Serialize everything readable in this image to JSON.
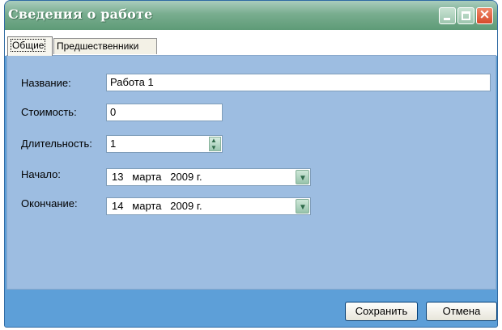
{
  "window": {
    "title": "Сведения о работе",
    "accent_color": "#5e9b77",
    "panel_color": "#9dbde1",
    "frame_color": "#5d9fd8"
  },
  "tabs": [
    {
      "label": "Общие",
      "selected": true
    },
    {
      "label": "Предшественники",
      "selected": false
    }
  ],
  "form": {
    "name_label": "Название:",
    "name_value": "Работа 1",
    "cost_label": "Стоимость:",
    "cost_value": "0",
    "duration_label": "Длительность:",
    "duration_value": "1",
    "start_label": "Начало:",
    "start_value": "13   марта   2009 г.",
    "end_label": "Окончание:",
    "end_value": "14   марта   2009 г."
  },
  "buttons": {
    "save": "Сохранить",
    "cancel": "Отмена"
  },
  "icons": {
    "minimize": "minimize-icon",
    "maximize": "maximize-icon",
    "close": "close-icon",
    "spin": "spin-updown-icon",
    "dropdown": "chevron-down-icon"
  }
}
